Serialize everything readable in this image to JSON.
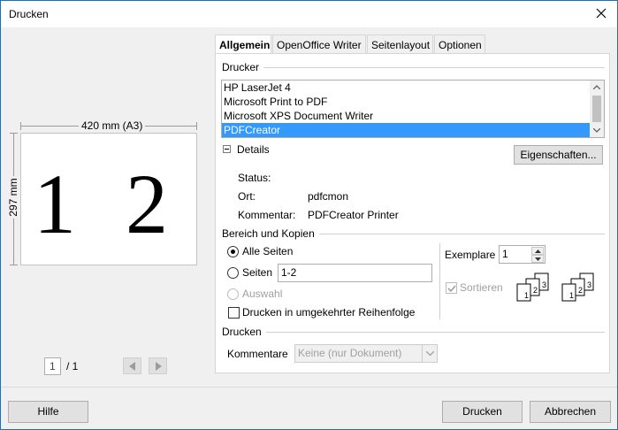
{
  "window": {
    "title": "Drucken"
  },
  "preview": {
    "width_label": "420 mm (A3)",
    "height_label": "297 mm",
    "page_digits": [
      "1",
      "2"
    ],
    "page_number": "1",
    "page_total": "/ 1"
  },
  "tabs": [
    {
      "label": "Allgemein",
      "active": true
    },
    {
      "label": "OpenOffice Writer",
      "active": false
    },
    {
      "label": "Seitenlayout",
      "active": false
    },
    {
      "label": "Optionen",
      "active": false
    }
  ],
  "printer": {
    "section_title": "Drucker",
    "items": [
      "HP LaserJet 4",
      "Microsoft Print to PDF",
      "Microsoft XPS Document Writer",
      "PDFCreator"
    ],
    "selected": "PDFCreator",
    "details_toggle": "Details",
    "properties_button": "Eigenschaften...",
    "status_label": "Status:",
    "status_value": "",
    "location_label": "Ort:",
    "location_value": "pdfcmon",
    "comment_label": "Kommentar:",
    "comment_value": "PDFCreator Printer"
  },
  "range": {
    "section_title": "Bereich und Kopien",
    "all_pages": "Alle Seiten",
    "pages": "Seiten",
    "pages_value": "1-2",
    "selection": "Auswahl",
    "reverse_order": "Drucken in umgekehrter Reihenfolge",
    "copies_label": "Exemplare",
    "copies_value": "1",
    "collate_label": "Sortieren",
    "collate_checked": true
  },
  "print_section": {
    "section_title": "Drucken",
    "comments_label": "Kommentare",
    "comments_value": "Keine (nur Dokument)"
  },
  "footer": {
    "help_button": "Hilfe",
    "print_button": "Drucken",
    "cancel_button": "Abbrechen"
  },
  "colors": {
    "selection": "#3399ff",
    "window_border": "#1a6fbf"
  }
}
